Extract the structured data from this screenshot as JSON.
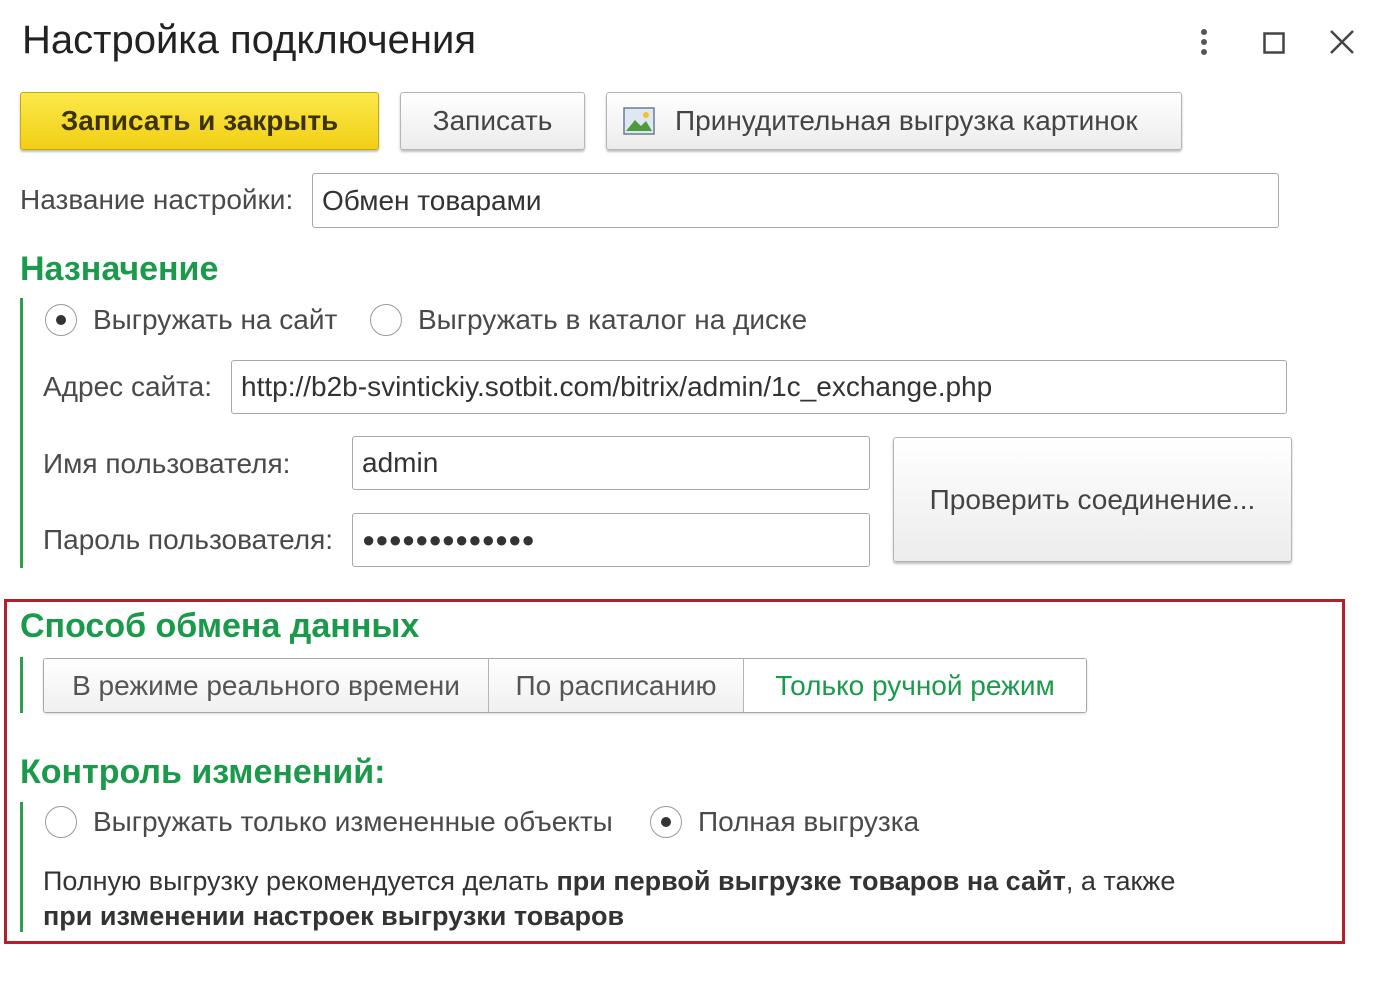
{
  "window": {
    "title": "Настройка подключения",
    "icons": [
      "more-icon",
      "maximize-icon",
      "close-icon"
    ]
  },
  "toolbar": {
    "save_close_label": "Записать и закрыть",
    "save_label": "Записать",
    "force_upload_label": "Принудительная выгрузка картинок"
  },
  "settings_name": {
    "label": "Название настройки:",
    "value": "Обмен товарами"
  },
  "purpose": {
    "title": "Назначение",
    "options": [
      "Выгружать на сайт",
      "Выгружать в каталог на диске"
    ],
    "selected": "Выгружать на сайт",
    "site_address_label": "Адрес сайта:",
    "site_address_value": "http://b2b-svintickiy.sotbit.com/bitrix/admin/1c_exchange.php",
    "username_label": "Имя пользователя:",
    "username_value": "admin",
    "password_label": "Пароль пользователя:",
    "password_value": "●●●●●●●●●●●●●",
    "check_connection_label": "Проверить соединение..."
  },
  "exchange_method": {
    "title": "Способ обмена  данных",
    "options": [
      "В режиме реального времени",
      "По расписанию",
      "Только ручной режим"
    ],
    "selected": "Только ручной режим"
  },
  "change_control": {
    "title": "Контроль изменений:",
    "options": [
      "Выгружать только измененные объекты",
      "Полная выгрузка"
    ],
    "selected": "Полная выгрузка",
    "note_part1": "Полную выгрузку рекомендуется делать ",
    "note_bold1": "при первой выгрузке товаров на сайт",
    "note_part2": ", а также",
    "note_bold2": "при изменении настроек выгрузки товаров"
  },
  "colors": {
    "accent_green": "#1a9a4a",
    "primary_yellow": "#f5d41f",
    "highlight_red": "#b3202a"
  }
}
